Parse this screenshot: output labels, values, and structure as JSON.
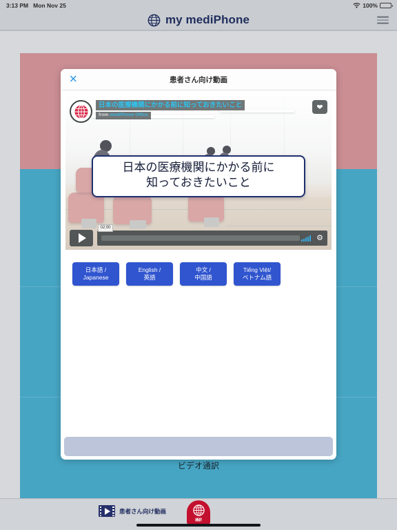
{
  "status_bar": {
    "time": "3:13 PM",
    "date": "Mon Nov 25",
    "battery_percent": "100%",
    "wifi_icon": "wifi-icon",
    "battery_icon": "battery-icon"
  },
  "header": {
    "brand": "my mediPhone",
    "logo_icon": "globe-icon",
    "menu_icon": "hamburger-menu-icon"
  },
  "modal": {
    "title": "患者さん向け動画",
    "close_label": "✕",
    "video": {
      "channel_logo_icon": "globe-logo-icon",
      "overlay_title": "日本の医療機関にかかる前に知っておきたいこと",
      "from_prefix": "from ",
      "from_source": "mediPhone Office",
      "favorite_icon": "heart-icon",
      "card_line1": "日本の医療機関にかかる前に",
      "card_line2": "知っておきたいこと",
      "play_icon": "play-icon",
      "timestamp": "02:00",
      "volume_icon": "volume-bars-icon",
      "settings_icon": "gear-icon"
    },
    "language_buttons": [
      {
        "line1": "日本語 /",
        "line2": "Japanese"
      },
      {
        "line1": "English /",
        "line2": "英語"
      },
      {
        "line1": "中文 /",
        "line2": "中国語"
      },
      {
        "line1": "Tiếng Việt/",
        "line2": "ベトナム語"
      }
    ]
  },
  "caption": "ビデオ通訳",
  "tabbar": {
    "video_tab_label": "患者さん向け動画",
    "video_tab_icon": "film-play-icon",
    "interpreter_tab_label": "通訳",
    "interpreter_tab_icon": "globe-icon"
  },
  "colors": {
    "brand_navy": "#1f2d5c",
    "accent_blue": "#3055cf",
    "link_blue": "#3399e8",
    "panel_rose": "#ca8e93",
    "panel_teal": "#46a5c3",
    "interpreter_red": "#c3102f",
    "chrome_gray": "#c9ccd1",
    "footer_bar": "#bcc5da"
  }
}
